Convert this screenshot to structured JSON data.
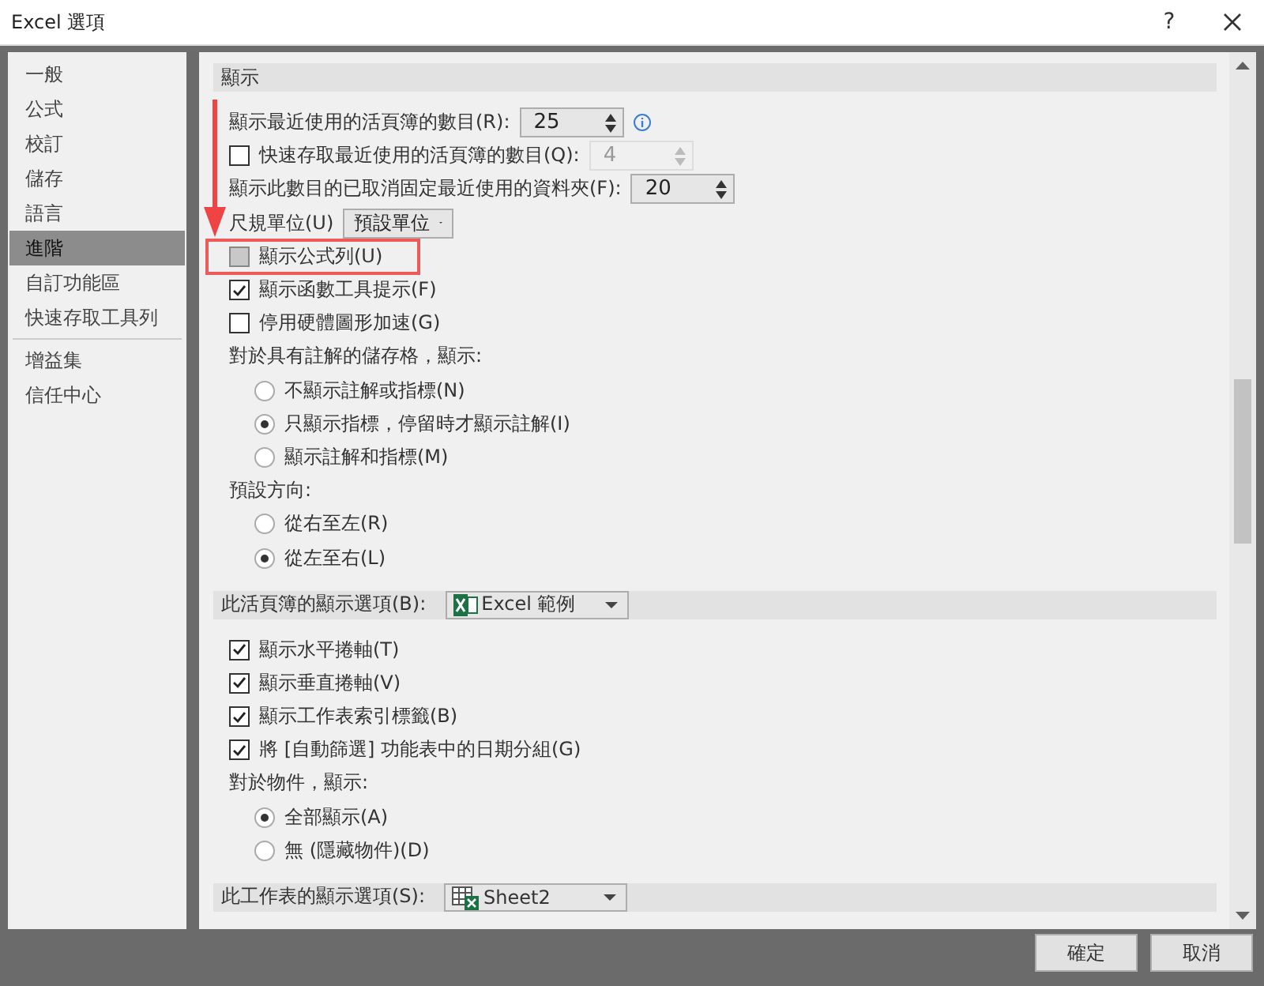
{
  "window": {
    "title": "Excel 選項",
    "help": "?"
  },
  "sidebar": {
    "groups": [
      {
        "items": [
          {
            "label": "一般",
            "selected": false
          },
          {
            "label": "公式",
            "selected": false
          },
          {
            "label": "校訂",
            "selected": false
          },
          {
            "label": "儲存",
            "selected": false
          },
          {
            "label": "語言",
            "selected": false
          },
          {
            "label": "進階",
            "selected": true
          },
          {
            "label": "自訂功能區",
            "selected": false
          },
          {
            "label": "快速存取工具列",
            "selected": false
          }
        ]
      },
      {
        "items": [
          {
            "label": "增益集",
            "selected": false
          },
          {
            "label": "信任中心",
            "selected": false
          }
        ]
      }
    ]
  },
  "sections": [
    {
      "title": "顯示",
      "rows": [
        {
          "kind": "spin",
          "label": "顯示最近使用的活頁簿的數目(R):",
          "value": "25",
          "info": true
        },
        {
          "kind": "check_spin",
          "label": "快速存取最近使用的活頁簿的數目(Q):",
          "checked": false,
          "value": "4",
          "disabled": true
        },
        {
          "kind": "spin",
          "label": "顯示此數目的已取消固定最近使用的資料夾(F):",
          "value": "20"
        },
        {
          "kind": "dropdown",
          "label": "尺規單位(U)",
          "value": "預設單位"
        },
        {
          "kind": "checkbox",
          "label": "顯示公式列(U)",
          "checked": false,
          "highlighted": true
        },
        {
          "kind": "checkbox",
          "label": "顯示函數工具提示(F)",
          "checked": true,
          "highlighted": false
        },
        {
          "kind": "checkbox",
          "label": "停用硬體圖形加速(G)",
          "checked": false,
          "highlighted": false
        },
        {
          "kind": "label",
          "label": "對於具有註解的儲存格，顯示:"
        },
        {
          "kind": "radio",
          "label": "不顯示註解或指標(N)",
          "selected": false
        },
        {
          "kind": "radio",
          "label": "只顯示指標，停留時才顯示註解(I)",
          "selected": true
        },
        {
          "kind": "radio",
          "label": "顯示註解和指標(M)",
          "selected": false
        },
        {
          "kind": "label",
          "label": "預設方向:"
        },
        {
          "kind": "radio",
          "label": "從右至左(R)",
          "selected": false
        },
        {
          "kind": "radio",
          "label": "從左至右(L)",
          "selected": true
        }
      ]
    },
    {
      "title": "此活頁簿的顯示選項(B):",
      "dropdown": {
        "kind": "workbook",
        "value": "Excel 範例"
      },
      "rows": [
        {
          "kind": "checkbox",
          "label": "顯示水平捲軸(T)",
          "checked": true,
          "highlighted": false
        },
        {
          "kind": "checkbox",
          "label": "顯示垂直捲軸(V)",
          "checked": true,
          "highlighted": false
        },
        {
          "kind": "checkbox",
          "label": "顯示工作表索引標籤(B)",
          "checked": true,
          "highlighted": false
        },
        {
          "kind": "checkbox",
          "label": "將 [自動篩選] 功能表中的日期分組(G)",
          "checked": true,
          "highlighted": false
        },
        {
          "kind": "label",
          "label": "對於物件，顯示:"
        },
        {
          "kind": "radio",
          "label": "全部顯示(A)",
          "selected": true
        },
        {
          "kind": "radio",
          "label": "無 (隱藏物件)(D)",
          "selected": false
        }
      ]
    },
    {
      "title": "此工作表的顯示選項(S):",
      "dropdown": {
        "kind": "sheet",
        "value": "Sheet2"
      }
    }
  ],
  "buttons": [
    "確定",
    "取消"
  ]
}
